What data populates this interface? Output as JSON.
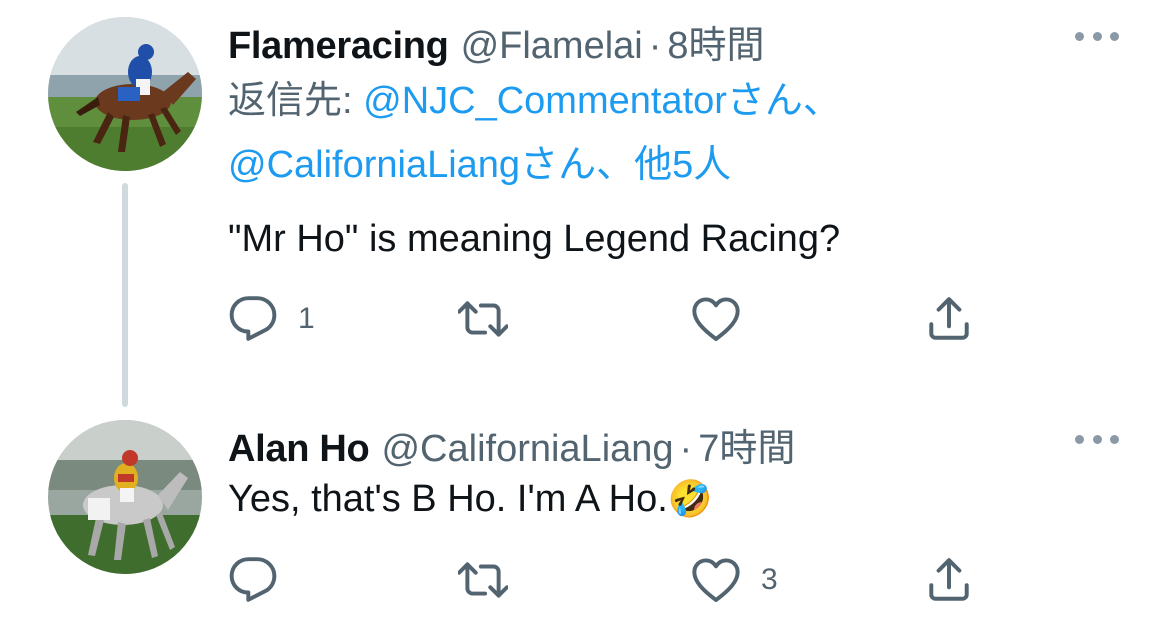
{
  "tweets": [
    {
      "display_name": "Flameracing",
      "handle": "@Flamelai",
      "separator": "·",
      "time": "8時間",
      "reply_prefix": "返信先:",
      "reply_mention_1": "@NJC_Commentatorさん、",
      "reply_mention_2": "@CaliforniaLiangさん、他5人",
      "text": "\"Mr Ho\" is meaning Legend Racing?",
      "actions": {
        "reply_count": "1",
        "retweet_count": "",
        "like_count": ""
      }
    },
    {
      "display_name": "Alan Ho",
      "handle": "@CaliforniaLiang",
      "separator": "·",
      "time": "7時間",
      "text": "Yes, that's B Ho. I'm A Ho.",
      "emoji": "🤣",
      "actions": {
        "reply_count": "",
        "retweet_count": "",
        "like_count": "3"
      }
    }
  ],
  "icons": {
    "reply": "reply-icon",
    "retweet": "retweet-icon",
    "like": "like-icon",
    "share": "share-icon",
    "more": "more-icon"
  },
  "colors": {
    "link": "#1d9bf0",
    "secondary_text": "#536471",
    "thread_line": "#cfd9de"
  }
}
